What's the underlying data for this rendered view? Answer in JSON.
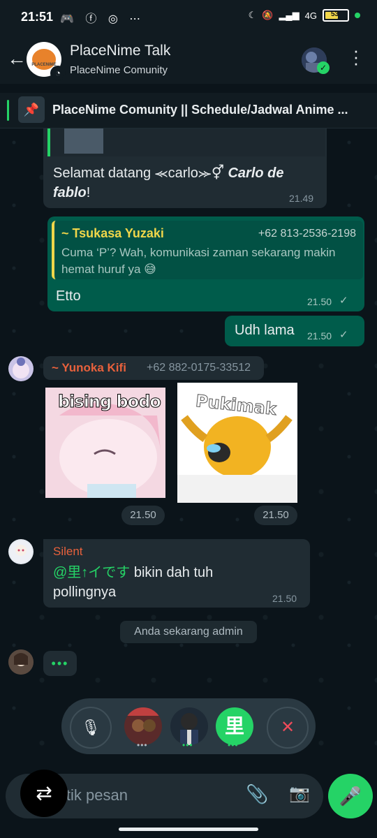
{
  "status_bar": {
    "time": "21:51",
    "left_icons": "🎮 ⓕ ◎ ⋯",
    "signal_text": "4G",
    "battery_level": "53"
  },
  "header": {
    "title": "PlaceNime Talk",
    "subtitle": "PlaceNime Comunity",
    "avatar_text": "PLACENIME"
  },
  "pinned": {
    "text": "PlaceNime Comunity || Schedule/Jadwal Anime ..."
  },
  "messages": [
    {
      "type": "incoming",
      "text_prefix": "Selamat datang ⪻carlo⪼⚥ ",
      "text_bold": "Carlo de fablo",
      "text_suffix": "!",
      "time": "21.49"
    },
    {
      "type": "outgoing",
      "quote_name": "~ Tsukasa Yuzaki",
      "quote_phone": "+62 813-2536-2198",
      "quote_text": "Cuma ‘P’? Wah, komunikasi zaman sekarang makin hemat huruf ya 😅",
      "text": "Etto",
      "time": "21.50"
    },
    {
      "type": "outgoing",
      "text": "Udh lama",
      "time": "21.50"
    },
    {
      "type": "incoming-stickers",
      "sender_name": "~ Yunoka Kifi",
      "sender_phone": "+62 882-0175-33512",
      "sticker1_caption": "bising bodo",
      "sticker2_caption": "Pukimak",
      "time1": "21.50",
      "time2": "21.50"
    },
    {
      "type": "incoming",
      "sender_name": "Silent",
      "mention": "@里↑イです",
      "text": " bikin dah tuh pollingnya",
      "time": "21.50"
    }
  ],
  "system_message": "Anda sekarang admin",
  "typing_indicator": "•••",
  "voice_chat": {
    "participant_3_initial": "里",
    "participant_dots": "•••"
  },
  "input": {
    "placeholder": "Ketik pesan"
  },
  "colors": {
    "accent_green": "#25d366",
    "outgoing_bubble": "#005c4b",
    "incoming_bubble": "#202c33",
    "background": "#0b141a"
  },
  "icons": [
    "back-arrow-icon",
    "community-icon",
    "menu-dots-icon",
    "pin-icon",
    "check-icon",
    "mic-off-icon",
    "close-icon",
    "switch-camera-icon",
    "attach-icon",
    "camera-icon",
    "mic-icon"
  ]
}
